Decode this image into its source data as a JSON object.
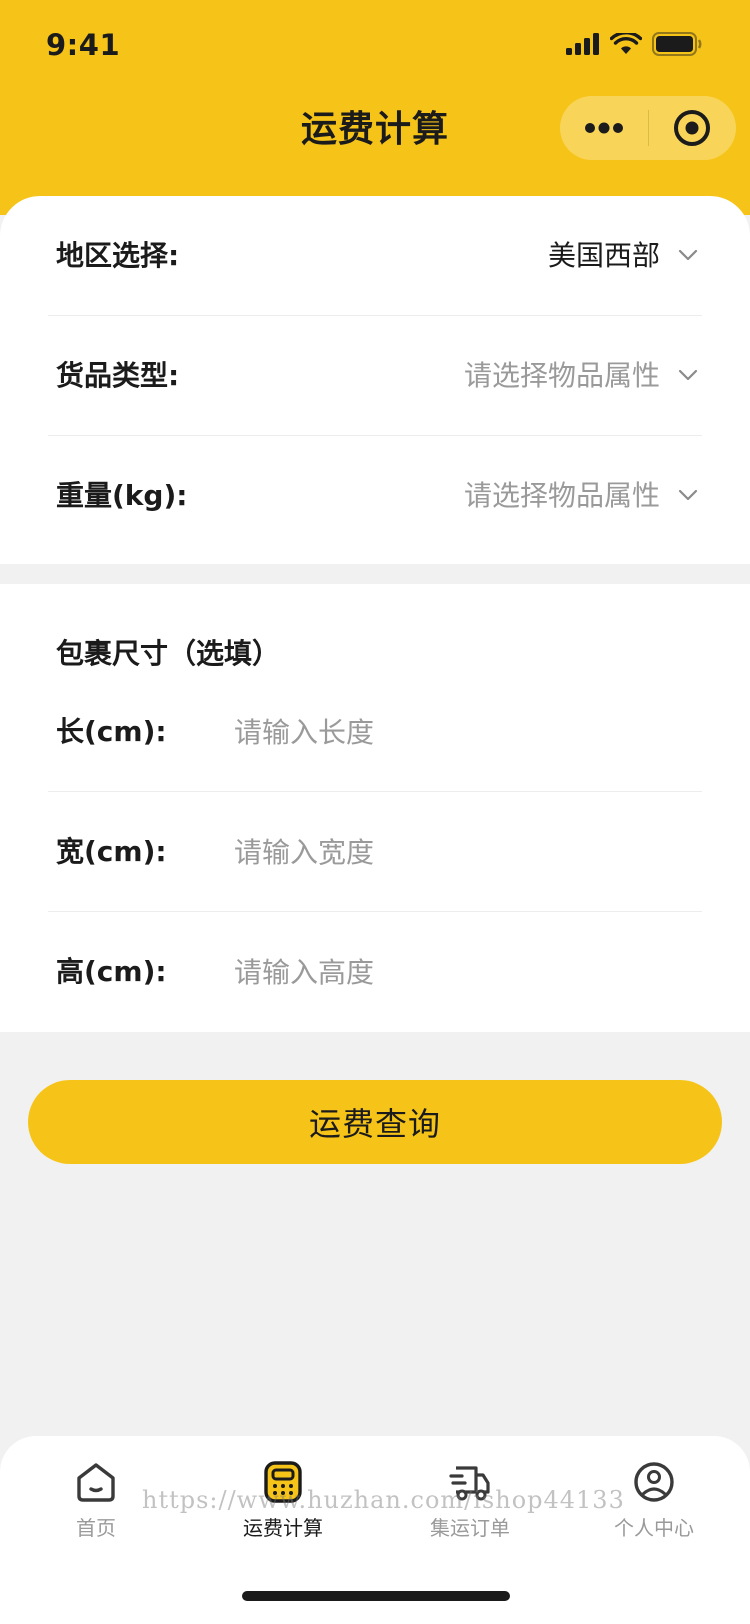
{
  "status_bar": {
    "time": "9:41"
  },
  "nav": {
    "title": "运费计算",
    "more_icon": "more-dots-icon",
    "target_icon": "target-icon"
  },
  "form": {
    "rows": [
      {
        "label": "地区选择:",
        "value": "美国西部",
        "is_placeholder": false
      },
      {
        "label": "货品类型:",
        "value": "请选择物品属性",
        "is_placeholder": true
      },
      {
        "label": "重量(kg):",
        "value": "请选择物品属性",
        "is_placeholder": true
      }
    ]
  },
  "package": {
    "title": "包裹尺寸（选填）",
    "fields": [
      {
        "label": "长(cm):",
        "placeholder": "请输入长度"
      },
      {
        "label": "宽(cm):",
        "placeholder": "请输入宽度"
      },
      {
        "label": "高(cm):",
        "placeholder": "请输入高度"
      }
    ]
  },
  "query_button": {
    "label": "运费查询"
  },
  "tabbar": {
    "tabs": [
      {
        "label": "首页",
        "icon": "home-icon",
        "active": false
      },
      {
        "label": "运费计算",
        "icon": "calculator-icon",
        "active": true
      },
      {
        "label": "集运订单",
        "icon": "truck-icon",
        "active": false
      },
      {
        "label": "个人中心",
        "icon": "user-icon",
        "active": false
      }
    ]
  },
  "watermark": "https://www.huzhan.com/ishop44133",
  "colors": {
    "brand": "#f6c419",
    "text": "#1b1b1b",
    "placeholder": "#9a9a9a",
    "background": "#f1f1f1"
  }
}
